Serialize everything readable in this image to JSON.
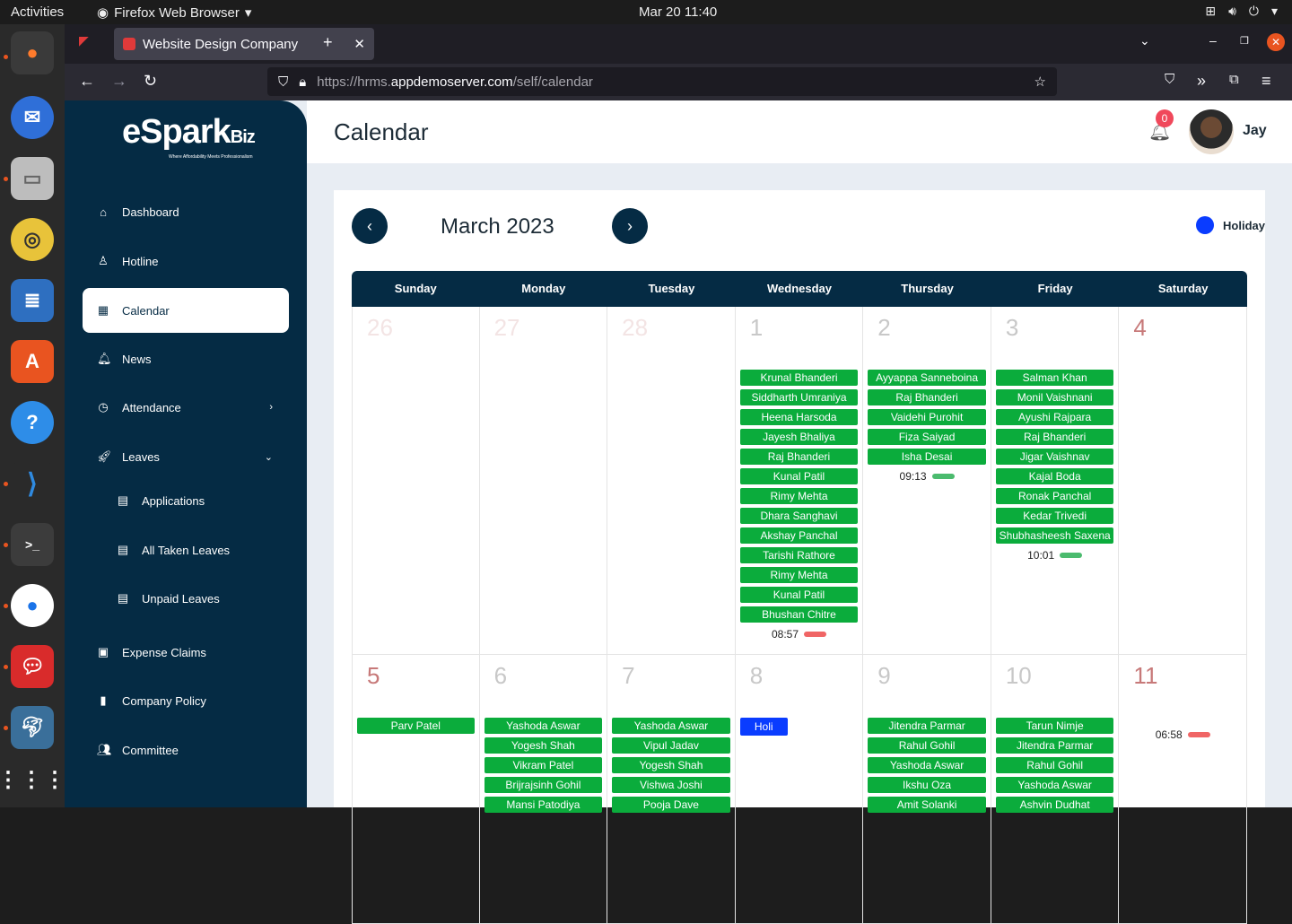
{
  "os": {
    "activities": "Activities",
    "app_name": "Firefox Web Browser",
    "clock": "Mar 20  11:40"
  },
  "browser": {
    "tab_title": "Website Design Company",
    "url_prefix": "https://hrms.",
    "url_domain": "appdemoserver.com",
    "url_path": "/self/calendar"
  },
  "sidebar": {
    "logo_main": "eSpark",
    "logo_small": "Biz",
    "logo_tagline": "Where Affordability Meets Professionalism",
    "items": [
      {
        "label": "Dashboard"
      },
      {
        "label": "Hotline"
      },
      {
        "label": "Calendar"
      },
      {
        "label": "News"
      },
      {
        "label": "Attendance"
      },
      {
        "label": "Leaves"
      },
      {
        "label": "Applications"
      },
      {
        "label": "All Taken Leaves"
      },
      {
        "label": "Unpaid Leaves"
      },
      {
        "label": "Expense Claims"
      },
      {
        "label": "Company Policy"
      },
      {
        "label": "Committee"
      }
    ]
  },
  "header": {
    "title": "Calendar",
    "notification_count": "0",
    "user_name": "Jay"
  },
  "calendar": {
    "month_title": "March 2023",
    "legend_label": "Holiday",
    "weekdays": [
      "Sunday",
      "Monday",
      "Tuesday",
      "Wednesday",
      "Thursday",
      "Friday",
      "Saturday"
    ],
    "week1": [
      {
        "day": "26",
        "events": []
      },
      {
        "day": "27",
        "events": []
      },
      {
        "day": "28",
        "events": []
      },
      {
        "day": "1",
        "events": [
          "Krunal Bhanderi",
          "Siddharth Umraniya",
          "Heena Harsoda",
          "Jayesh Bhaliya",
          "Raj Bhanderi",
          "Kunal Patil",
          "Rimy Mehta",
          "Dhara Sanghavi",
          "Akshay Panchal",
          "Tarishi Rathore",
          "Rimy Mehta",
          "Kunal Patil",
          "Bhushan Chitre"
        ],
        "time": "08:57"
      },
      {
        "day": "2",
        "events": [
          "Ayyappa Sanneboina",
          "Raj Bhanderi",
          "Vaidehi Purohit",
          "Fiza Saiyad",
          "Isha Desai"
        ],
        "time": "09:13"
      },
      {
        "day": "3",
        "events": [
          "Salman Khan",
          "Monil Vaishnani",
          "Ayushi Rajpara",
          "Raj Bhanderi",
          "Jigar Vaishnav",
          "Kajal Boda",
          "Ronak Panchal",
          "Kedar Trivedi",
          "Shubhasheesh Saxena"
        ],
        "time": "10:01"
      },
      {
        "day": "4",
        "events": []
      }
    ],
    "week2": [
      {
        "day": "5",
        "events": [
          "Parv Patel"
        ]
      },
      {
        "day": "6",
        "events": [
          "Yashoda Aswar",
          "Yogesh Shah",
          "Vikram Patel",
          "Brijrajsinh Gohil",
          "Mansi Patodiya"
        ]
      },
      {
        "day": "7",
        "events": [
          "Yashoda Aswar",
          "Vipul Jadav",
          "Yogesh Shah",
          "Vishwa Joshi",
          "Pooja Dave"
        ]
      },
      {
        "day": "8",
        "holiday": "Holi"
      },
      {
        "day": "9",
        "events": [
          "Jitendra Parmar",
          "Rahul Gohil",
          "Yashoda Aswar",
          "Ikshu Oza",
          "Amit Solanki"
        ]
      },
      {
        "day": "10",
        "events": [
          "Tarun Nimje",
          "Jitendra Parmar",
          "Rahul Gohil",
          "Yashoda Aswar",
          "Ashvin Dudhat"
        ]
      },
      {
        "day": "11",
        "events": [],
        "time": "06:58"
      }
    ]
  }
}
